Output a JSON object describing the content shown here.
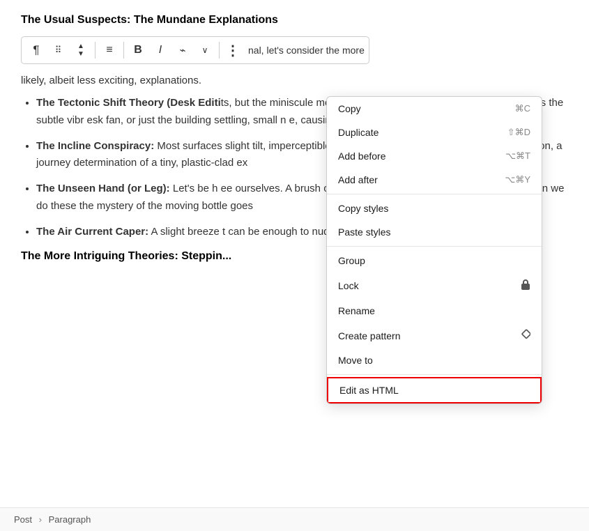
{
  "document": {
    "title": "The Usual Suspects: The Mundane Explanations",
    "intro": "nal, let's consider the more likely, albeit less exciting, explanations.",
    "bullets": [
      {
        "bold_part": "The Tectonic Shift Theory (Desk Editi",
        "text": "ts, but the miniscule movements of your d eed play a role. Whether it's the subtle vibr esk fan, or just the building settling, small n e, causing your water bottle to migrate."
      },
      {
        "bold_part": "The Incline Conspiracy:",
        "text": "Most surfaces slight tilt, imperceptible to the naked e ttle to slowly roll in one direction, a journey determination of a tiny, plastic-clad ex"
      },
      {
        "bold_part": "The Unseen Hand (or Leg):",
        "text": "Let's be h ee ourselves. A brush of a hand, a nudge nd might be the culprit. Often we do these the mystery of the moving bottle goes"
      },
      {
        "bold_part": "The Air Current Caper:",
        "text": "A slight breeze t can be enough to nudge a lightweight y if it's almost empty."
      }
    ],
    "section_heading": "The More Intriguing Theories: Steppin..."
  },
  "toolbar": {
    "items": [
      {
        "name": "pilcrow",
        "label": "¶"
      },
      {
        "name": "grid",
        "label": "⠿"
      },
      {
        "name": "updown",
        "label": "⌃"
      },
      {
        "name": "align",
        "label": "≡"
      },
      {
        "name": "bold",
        "label": "B"
      },
      {
        "name": "italic",
        "label": "I"
      },
      {
        "name": "link",
        "label": "⌁"
      },
      {
        "name": "chevron",
        "label": "∨"
      },
      {
        "name": "more",
        "label": "⋮"
      }
    ]
  },
  "context_menu": {
    "groups": [
      {
        "items": [
          {
            "name": "copy",
            "label": "Copy",
            "shortcut": "⌘C",
            "highlighted": true
          },
          {
            "name": "duplicate",
            "label": "Duplicate",
            "shortcut": "⇧⌘D"
          },
          {
            "name": "add-before",
            "label": "Add before",
            "shortcut": "⌥⌘T"
          },
          {
            "name": "add-after",
            "label": "Add after",
            "shortcut": "⌥⌘Y"
          }
        ]
      },
      {
        "items": [
          {
            "name": "copy-styles",
            "label": "Copy styles",
            "shortcut": ""
          },
          {
            "name": "paste-styles",
            "label": "Paste styles",
            "shortcut": ""
          }
        ]
      },
      {
        "items": [
          {
            "name": "group",
            "label": "Group",
            "shortcut": ""
          },
          {
            "name": "lock",
            "label": "Lock",
            "shortcut": "lock-icon"
          },
          {
            "name": "rename",
            "label": "Rename",
            "shortcut": ""
          },
          {
            "name": "create-pattern",
            "label": "Create pattern",
            "shortcut": "diamond-icon"
          },
          {
            "name": "move-to",
            "label": "Move to",
            "shortcut": ""
          }
        ]
      },
      {
        "items": [
          {
            "name": "edit-as-html",
            "label": "Edit as HTML",
            "shortcut": "",
            "highlighted_red": true
          }
        ]
      }
    ]
  },
  "status_bar": {
    "breadcrumb": [
      "Post",
      "Paragraph"
    ]
  }
}
